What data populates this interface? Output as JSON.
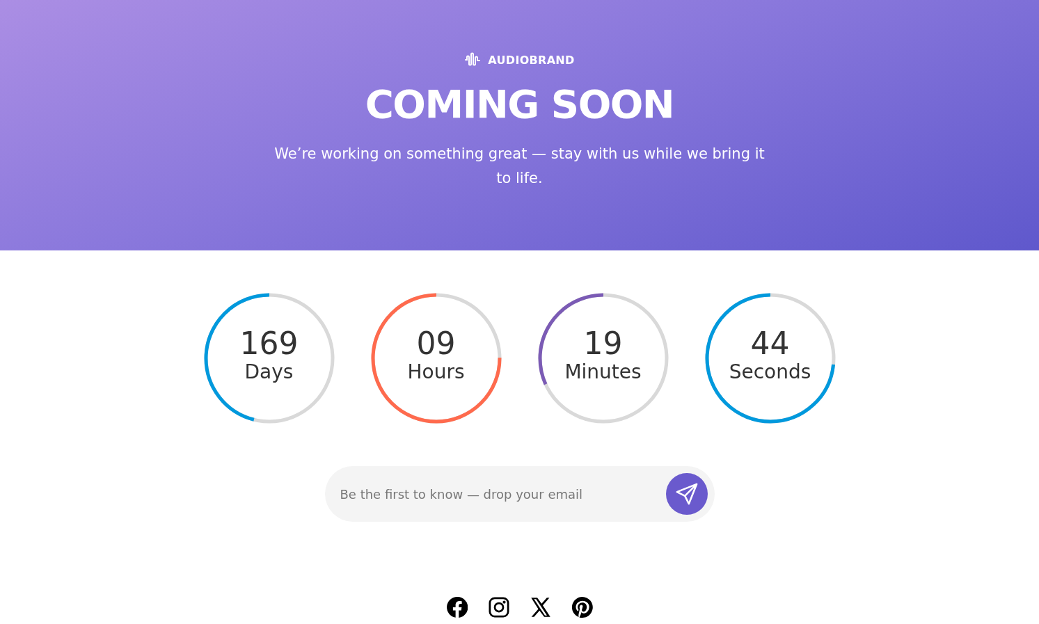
{
  "brand": {
    "name": "AUDIOBRAND"
  },
  "hero": {
    "title": "COMING SOON",
    "subtitle": "We’re working on something great — stay with us while we bring it to life."
  },
  "countdown": [
    {
      "value": "169",
      "unit": "Days",
      "level": 0.46,
      "color": "#0099dd"
    },
    {
      "value": "09",
      "unit": "Hours",
      "level": 0.75,
      "color": "#ff6a4d"
    },
    {
      "value": "19",
      "unit": "Minutes",
      "level": 0.317,
      "color": "#7b5bb5"
    },
    {
      "value": "44",
      "unit": "Seconds",
      "level": 0.733,
      "color": "#0099dd"
    }
  ],
  "subscribe": {
    "placeholder": "Be the first to know — drop your email"
  },
  "social": [
    {
      "kind": "facebook"
    },
    {
      "kind": "instagram"
    },
    {
      "kind": "x"
    },
    {
      "kind": "pinterest"
    }
  ]
}
